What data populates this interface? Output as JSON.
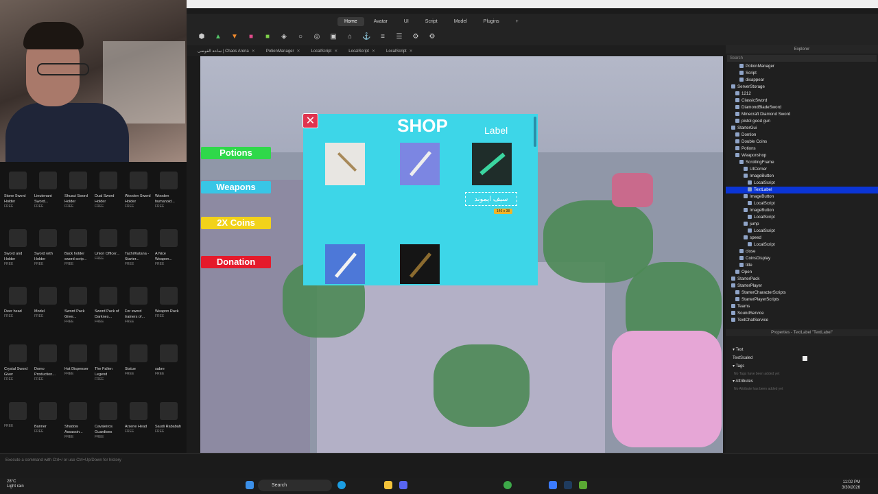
{
  "studio": {
    "menu_tabs": [
      "Home",
      "Avatar",
      "UI",
      "Script",
      "Model",
      "Plugins",
      "+"
    ],
    "active_tab": "Home",
    "doc_tabs": [
      "ساحة الفوضى | Chaos Arena",
      "PotionManager",
      "LocalScript",
      "LocalScript",
      "LocalScript"
    ]
  },
  "toolbox": {
    "items": [
      {
        "name": "Stone Sword Holder",
        "price": "FREE"
      },
      {
        "name": "Lieutenant Sword...",
        "price": "FREE"
      },
      {
        "name": "Shusui Sword Holder",
        "price": "FREE"
      },
      {
        "name": "Dual Sword Holder",
        "price": "FREE"
      },
      {
        "name": "Wooden Sword Holder",
        "price": "FREE"
      },
      {
        "name": "Wooden humanoid...",
        "price": "FREE"
      },
      {
        "name": "Sword and Holder",
        "price": "FREE"
      },
      {
        "name": "Sword with Holder",
        "price": "FREE"
      },
      {
        "name": "Back holder sword scrip...",
        "price": "FREE"
      },
      {
        "name": "Union Officer...",
        "price": "FREE"
      },
      {
        "name": "Tachi/Katana - Starter...",
        "price": "FREE"
      },
      {
        "name": "A Nice Weapon...",
        "price": "FREE"
      },
      {
        "name": "Deer head",
        "price": "FREE"
      },
      {
        "name": "Model",
        "price": "FREE"
      },
      {
        "name": "Sword Pack Giver...",
        "price": "FREE"
      },
      {
        "name": "Sword Pack of Darknes...",
        "price": "FREE"
      },
      {
        "name": "For sword trainers of...",
        "price": "FREE"
      },
      {
        "name": "Weapon Rack",
        "price": "FREE"
      },
      {
        "name": "Crystal Sword Giver",
        "price": "FREE"
      },
      {
        "name": "Domo Production...",
        "price": "FREE"
      },
      {
        "name": "Hat Dispenser",
        "price": "FREE"
      },
      {
        "name": "The Fallen Legend",
        "price": "FREE"
      },
      {
        "name": "Statue",
        "price": "FREE"
      },
      {
        "name": "sabre",
        "price": "FREE"
      },
      {
        "name": "",
        "price": "FREE"
      },
      {
        "name": "Banner",
        "price": "FREE"
      },
      {
        "name": "Shadow Assassin...",
        "price": "FREE"
      },
      {
        "name": "Cavaleiros Guardioes",
        "price": "FREE"
      },
      {
        "name": "Arsene Head",
        "price": "FREE"
      },
      {
        "name": "Saudi Rababah",
        "price": "FREE"
      }
    ]
  },
  "shop": {
    "title": "SHOP",
    "close": "✕",
    "label": "Label",
    "selected_text": "سيف ايموند",
    "size_tag": "146 x 38",
    "side_buttons": [
      {
        "label": "Potions",
        "color": "#2fd84a"
      },
      {
        "label": "Weapons",
        "color": "#38c6e6"
      },
      {
        "label": "2X Coins",
        "color": "#f2d21a"
      },
      {
        "label": "Donation",
        "color": "#e51a2b"
      }
    ]
  },
  "explorer": {
    "title": "Explorer",
    "search_placeholder": "Search",
    "rows": [
      {
        "label": "PotionManager",
        "indent": 2
      },
      {
        "label": "Script",
        "indent": 2
      },
      {
        "label": "disappear",
        "indent": 2
      },
      {
        "label": "ServerStorage",
        "indent": 0
      },
      {
        "label": "1212",
        "indent": 1
      },
      {
        "label": "ClassicSword",
        "indent": 1
      },
      {
        "label": "DiamondBladeSword",
        "indent": 1
      },
      {
        "label": "Minecraft Diamond Sword",
        "indent": 1
      },
      {
        "label": "pistol good gun",
        "indent": 1
      },
      {
        "label": "StarterGui",
        "indent": 0
      },
      {
        "label": "Dontion",
        "indent": 1
      },
      {
        "label": "Double Coins",
        "indent": 1
      },
      {
        "label": "Potions",
        "indent": 1
      },
      {
        "label": "Weaponshop",
        "indent": 1
      },
      {
        "label": "ScrollingFrame",
        "indent": 2
      },
      {
        "label": "UICorner",
        "indent": 3
      },
      {
        "label": "ImageButton",
        "indent": 3
      },
      {
        "label": "LocalScript",
        "indent": 4
      },
      {
        "label": "TextLabel",
        "indent": 4,
        "selected": true
      },
      {
        "label": "ImageButton",
        "indent": 3
      },
      {
        "label": "LocalScript",
        "indent": 4
      },
      {
        "label": "ImageButton",
        "indent": 3
      },
      {
        "label": "LocalScript",
        "indent": 4
      },
      {
        "label": "jump",
        "indent": 3
      },
      {
        "label": "LocalScript",
        "indent": 4
      },
      {
        "label": "speed",
        "indent": 3
      },
      {
        "label": "LocalScript",
        "indent": 4
      },
      {
        "label": "close",
        "indent": 2
      },
      {
        "label": "CoinsDisplay",
        "indent": 2
      },
      {
        "label": "title",
        "indent": 2
      },
      {
        "label": "Open",
        "indent": 1
      },
      {
        "label": "StarterPack",
        "indent": 0
      },
      {
        "label": "StarterPlayer",
        "indent": 0
      },
      {
        "label": "StarterCharacterScripts",
        "indent": 1
      },
      {
        "label": "StarterPlayerScripts",
        "indent": 1
      },
      {
        "label": "Teams",
        "indent": 0
      },
      {
        "label": "SoundService",
        "indent": 0
      },
      {
        "label": "TextChatService",
        "indent": 0
      }
    ]
  },
  "properties": {
    "title": "Properties - TextLabel \"TextLabel\"",
    "section_text": "Text",
    "text_scaled": "TextScaled",
    "section_tags": "Tags",
    "tags_note": "No Tags have been added yet",
    "section_attributes": "Attributes",
    "attributes_note": "No Attribute has been added yet"
  },
  "command_bar": {
    "placeholder": "Execute a command with Ctrl+/ or use Ctrl+Up/Down for history"
  },
  "taskbar": {
    "weather_temp": "28°C",
    "weather_desc": "Light rain",
    "search": "Search",
    "time": "11:02 PM",
    "date": "3/30/2026"
  }
}
